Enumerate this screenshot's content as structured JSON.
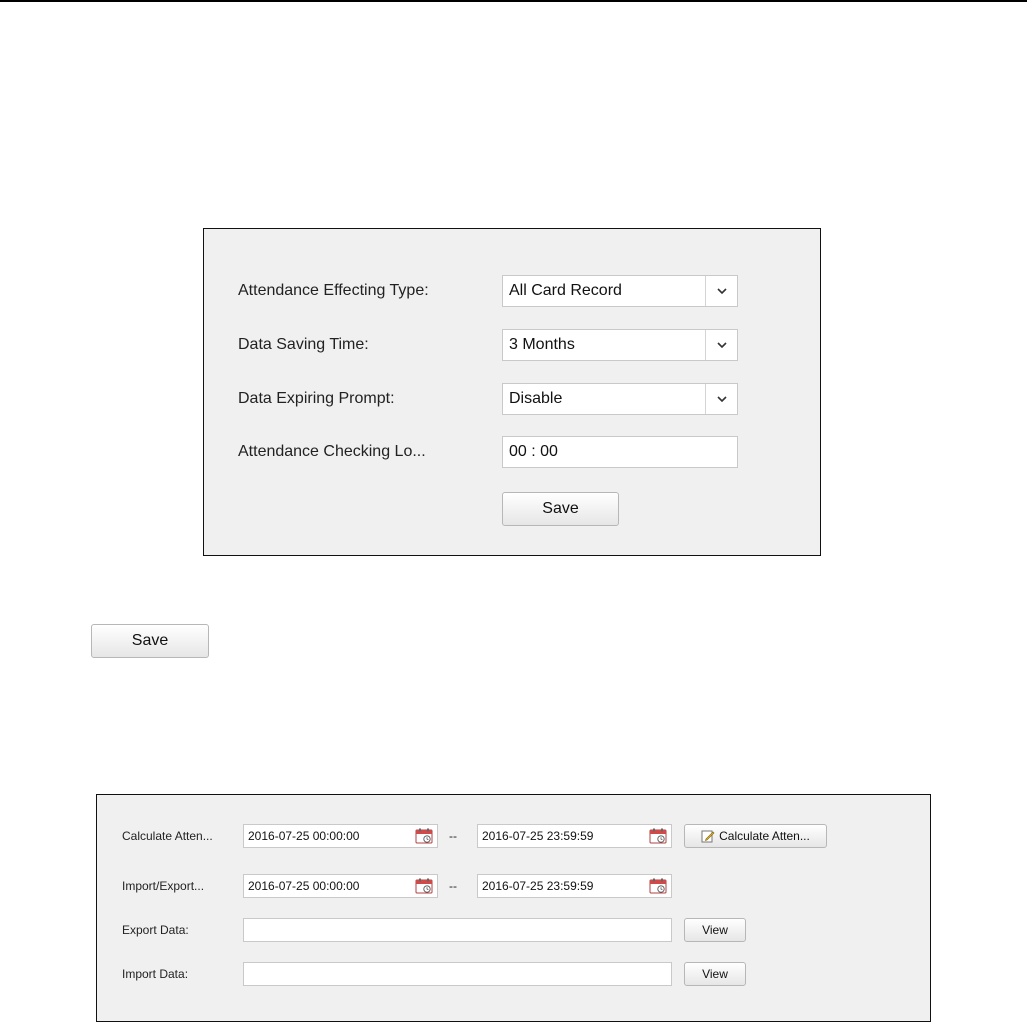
{
  "settings_panel": {
    "rows": [
      {
        "label": "Attendance Effecting Type:",
        "value": "All Card Record"
      },
      {
        "label": "Data Saving Time:",
        "value": "3 Months"
      },
      {
        "label": "Data Expiring Prompt:",
        "value": "Disable"
      },
      {
        "label": "Attendance Checking Lo...",
        "value": "00 : 00"
      }
    ],
    "save_label": "Save"
  },
  "standalone_save_label": "Save",
  "calc_panel": {
    "calculate_row": {
      "label": "Calculate Atten...",
      "start": "2016-07-25 00:00:00",
      "separator": "--",
      "end": "2016-07-25 23:59:59",
      "button_label": "Calculate Atten..."
    },
    "import_export_row": {
      "label": "Import/Export...",
      "start": "2016-07-25 00:00:00",
      "separator": "--",
      "end": "2016-07-25 23:59:59"
    },
    "export_row": {
      "label": "Export Data:",
      "value": "",
      "button_label": "View"
    },
    "import_row": {
      "label": "Import Data:",
      "value": "",
      "button_label": "View"
    }
  },
  "icons": {
    "dropdown": "chevron-down-icon",
    "calendar": "calendar-icon",
    "pencil": "pencil-icon"
  }
}
